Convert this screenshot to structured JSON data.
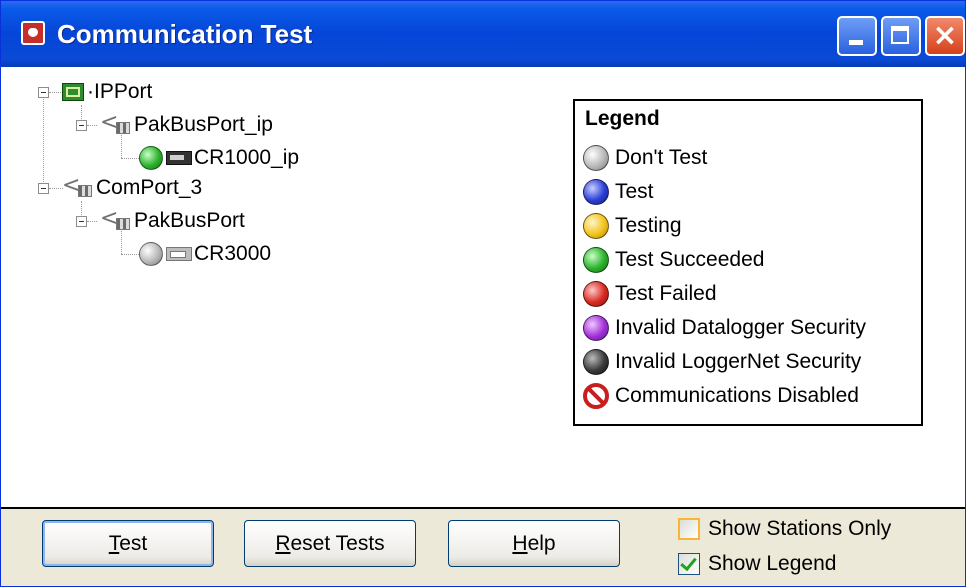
{
  "window": {
    "title": "Communication Test",
    "controls": {
      "minimize": "minimize",
      "maximize": "maximize",
      "close": "×"
    }
  },
  "tree": {
    "ipport": {
      "label": "IPPort",
      "icon": "ipport-icon"
    },
    "pakbusport_ip": {
      "label": "PakBusPort_ip",
      "icon": "serial-port-icon"
    },
    "cr1000_ip": {
      "label": "CR1000_ip",
      "status": "Test Succeeded",
      "status_color": "#2cb22c",
      "icon": "datalogger-icon"
    },
    "comport3": {
      "label": "ComPort_3",
      "icon": "serial-port-icon"
    },
    "pakbusport": {
      "label": "PakBusPort",
      "icon": "serial-port-icon"
    },
    "cr3000": {
      "label": "CR3000",
      "status": "Don't Test",
      "status_color": "#b8b8b8",
      "icon": "datalogger-icon"
    }
  },
  "legend": {
    "title": "Legend",
    "items": [
      {
        "label": "Don't Test",
        "color": "#b8b8b8"
      },
      {
        "label": "Test",
        "color": "#2b3fd6"
      },
      {
        "label": "Testing",
        "color": "#f3c31e"
      },
      {
        "label": "Test Succeeded",
        "color": "#2cb22c"
      },
      {
        "label": "Test Failed",
        "color": "#d82a20"
      },
      {
        "label": "Invalid Datalogger Security",
        "color": "#a231d8"
      },
      {
        "label": "Invalid LoggerNet Security",
        "color": "#3c3c3c"
      },
      {
        "label": "Communications Disabled",
        "color": "#c81e1e"
      }
    ]
  },
  "buttons": {
    "test": {
      "pre": "",
      "key": "T",
      "post": "est"
    },
    "reset": {
      "pre": "",
      "key": "R",
      "post": "eset Tests"
    },
    "help": {
      "pre": "",
      "key": "H",
      "post": "elp"
    }
  },
  "options": {
    "show_stations_only": {
      "label": "Show Stations Only",
      "checked": false
    },
    "show_legend": {
      "label": "Show Legend",
      "checked": true
    }
  }
}
